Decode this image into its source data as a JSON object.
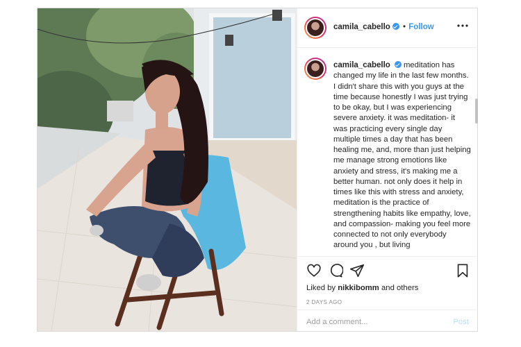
{
  "post": {
    "author": {
      "username": "camila_cabello",
      "verified": true,
      "follow_label": "Follow",
      "separator": "•"
    },
    "more_icon": "more-horizontal-icon",
    "caption": "meditation has changed my life in the last few months. I didn't share this with you guys at the time because honestly I was just trying to be okay, but I was experiencing severe anxiety. it was meditation- it was practicing every single day multiple times a day that has been healing me, and, more than just helping me manage strong emotions like anxiety and stress, it's making me a better human. not only does it help in times like this with stress and anxiety, meditation is the practice of strengthening habits like empathy, love, and compassion- making you feel more connected to not only everybody around you , but living",
    "actions": {
      "icons": [
        "heart-icon",
        "comment-icon",
        "share-icon",
        "bookmark-icon"
      ]
    },
    "likes": {
      "prefix": "Liked by",
      "user": "nikkibomm",
      "suffix": "and others"
    },
    "timestamp": "2 days ago",
    "comment_box": {
      "placeholder": "Add a comment...",
      "post_label": "Post"
    },
    "colors": {
      "link_blue": "#3897f0",
      "post_disabled": "#b2dffc",
      "border": "#dbdbdb"
    }
  }
}
